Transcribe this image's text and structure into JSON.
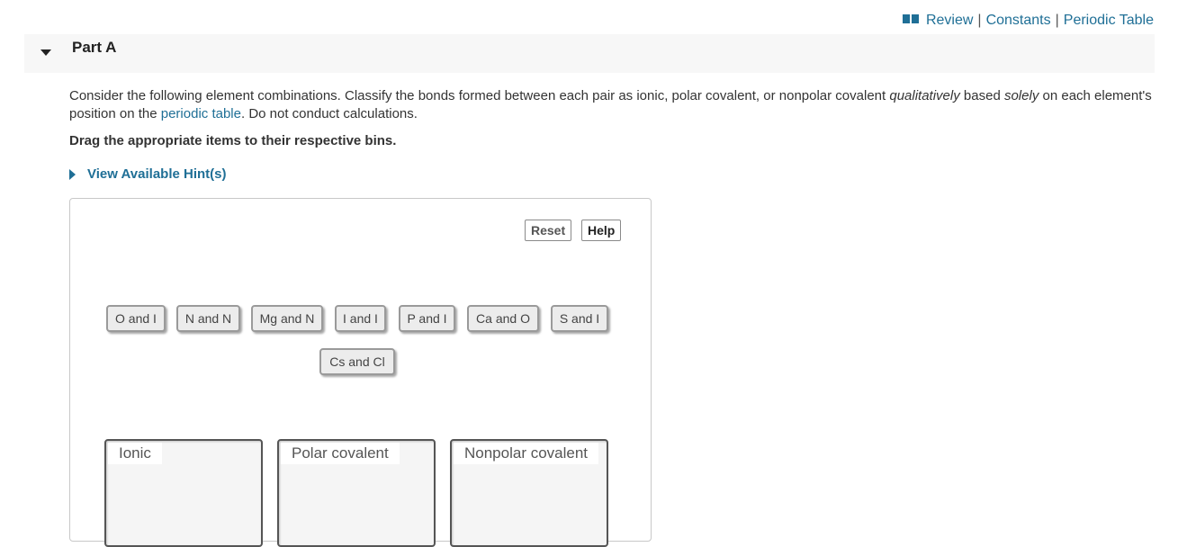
{
  "top_links": {
    "review": "Review",
    "constants": "Constants",
    "periodic_table": "Periodic Table",
    "separator": "|",
    "book_icon": "book-icon"
  },
  "part": {
    "title": "Part A",
    "collapse_icon": "caret-down-icon"
  },
  "question": {
    "text_1": "Consider the following element combinations. Classify the bonds formed between each pair as ionic, polar covalent, or nonpolar covalent ",
    "italic_1": "qualitatively",
    "text_2": " based ",
    "italic_2": "solely",
    "text_3": " on each element's position on the ",
    "link": "periodic table",
    "text_4": ". Do not conduct calculations."
  },
  "instruction": "Drag the appropriate items to their respective bins.",
  "hints": {
    "label": "View Available Hint(s)",
    "icon": "caret-right-icon"
  },
  "buttons": {
    "reset": "Reset",
    "help": "Help"
  },
  "items": [
    "O and I",
    "N and N",
    "Mg and N",
    "I and I",
    "P and I",
    "Ca and O",
    "S and I",
    "Cs and Cl"
  ],
  "bins": [
    "Ionic",
    "Polar covalent",
    "Nonpolar covalent"
  ],
  "colors": {
    "link": "#1f6f96",
    "header_bg": "#f7f7f7"
  }
}
